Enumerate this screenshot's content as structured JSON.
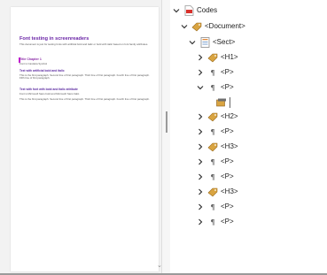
{
  "document": {
    "title": "Font testing in screenreaders",
    "intro": "This document is just for testing fonts with artificial bold and italic or bold with italic based on font family attributes.",
    "title_2": "Title Chapter 1",
    "title_2_sub": "Font is Candara Symbol",
    "h2_1": "Text with artificial bold and italic",
    "h2_1_text": "This is the first paragraph. Second line of first paragraph. Third line of first paragraph. Fourth line of first paragraph. Fifth line of first paragraph.",
    "h3_1": "Text with font with bold and italic attribute",
    "h3_1_text": "Font is Microsoft Sans bold and Microsoft Sans Italic.",
    "h3_1_para": "This is the first paragraph. Second line of first paragraph. Third line of first paragraph. Fourth line of first paragraph."
  },
  "tree": {
    "root": "Codes",
    "document": "<Document>",
    "sect": "<Sect>",
    "items": [
      {
        "label": "<H1>",
        "icon": "tag-icon"
      },
      {
        "label": "<P>",
        "icon": "pilcrow-icon"
      },
      {
        "label": "<P>",
        "icon": "pilcrow-icon",
        "expanded": true
      },
      {
        "label": "<H2>",
        "icon": "tag-icon"
      },
      {
        "label": "<P>",
        "icon": "pilcrow-icon"
      },
      {
        "label": "<H3>",
        "icon": "tag-icon"
      },
      {
        "label": "<P>",
        "icon": "pilcrow-icon"
      },
      {
        "label": "<P>",
        "icon": "pilcrow-icon"
      },
      {
        "label": "<H3>",
        "icon": "tag-icon"
      },
      {
        "label": "<P>",
        "icon": "pilcrow-icon"
      },
      {
        "label": "<P>",
        "icon": "pilcrow-icon"
      }
    ]
  },
  "colors": {
    "title": "#6a24a6",
    "heading": "#8a2aa6",
    "tag_icon": "#d9a441",
    "pdf_red": "#d9312b"
  }
}
